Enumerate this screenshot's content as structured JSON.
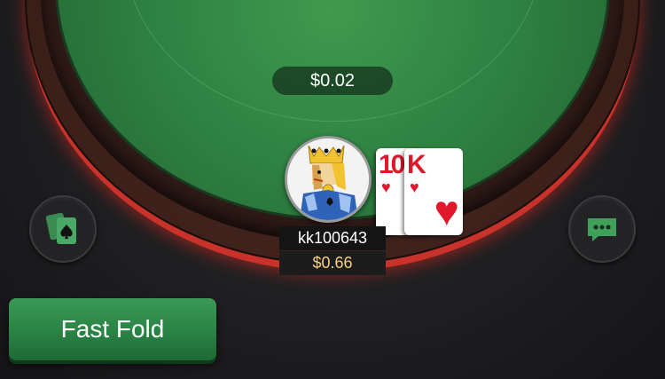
{
  "pot": {
    "amount": "$0.02"
  },
  "player": {
    "name": "kk100643",
    "stack": "$0.66",
    "avatar_icon": "king-avatar-icon",
    "cards": [
      {
        "rank": "10",
        "suit": "♥"
      },
      {
        "rank": "K",
        "suit": "♥"
      }
    ]
  },
  "buttons": {
    "fast_fold_label": "Fast Fold",
    "left_icon": "cards-spade-icon",
    "right_icon": "chat-bubble-icon"
  },
  "colors": {
    "felt": "#2f8242",
    "accent_green": "#2b8546",
    "rim_glow": "#c8322a",
    "stack_text": "#f4d083"
  }
}
